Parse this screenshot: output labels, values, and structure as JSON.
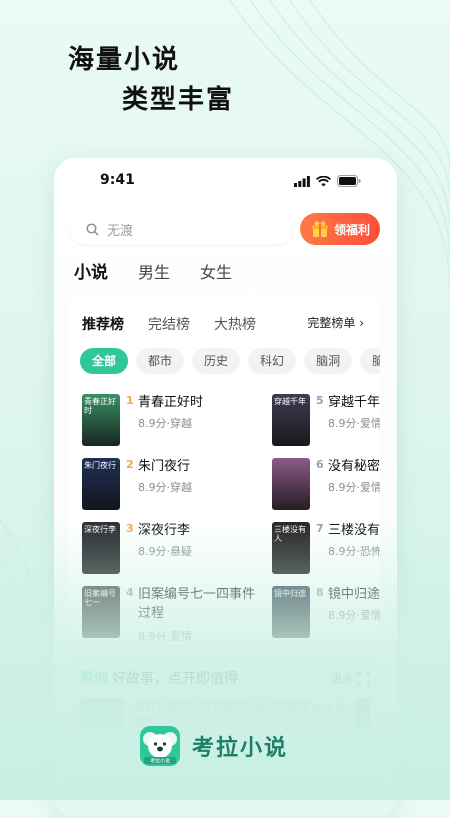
{
  "promo": {
    "line1": "海量小说",
    "line2": "类型丰富"
  },
  "status": {
    "time": "9:41"
  },
  "search": {
    "placeholder": "无渡"
  },
  "welfare": {
    "label": "领福利"
  },
  "tabs": [
    {
      "label": "小说",
      "active": true
    },
    {
      "label": "男生",
      "active": false
    },
    {
      "label": "女生",
      "active": false
    }
  ],
  "rank_tabs": [
    {
      "label": "推荐榜",
      "active": true
    },
    {
      "label": "完结榜",
      "active": false
    },
    {
      "label": "大热榜",
      "active": false
    }
  ],
  "full_rank": "完整榜单 ›",
  "categories": [
    {
      "label": "全部",
      "active": true
    },
    {
      "label": "都市",
      "active": false
    },
    {
      "label": "历史",
      "active": false
    },
    {
      "label": "科幻",
      "active": false
    },
    {
      "label": "脑洞",
      "active": false
    },
    {
      "label": "脑",
      "active": false
    }
  ],
  "books": [
    {
      "rank": "1",
      "title": "青春正好时",
      "meta": "8.9分·穿越",
      "cover_text": "青春正好时",
      "cover_color": "#3c8f67",
      "rank_color": "#f0a84a"
    },
    {
      "rank": "2",
      "title": "朱门夜行",
      "meta": "8.9分·穿越",
      "cover_text": "朱门夜行",
      "cover_color": "#1f2f57",
      "rank_color": "#f0a84a"
    },
    {
      "rank": "3",
      "title": "深夜行李",
      "meta": "8.9分·悬疑",
      "cover_text": "深夜行李",
      "cover_color": "#2b2f36",
      "rank_color": "#f0a84a"
    },
    {
      "rank": "4",
      "title": "旧案编号七一四事件过程",
      "meta": "8.9分·爱情",
      "cover_text": "旧案编号七一",
      "cover_color": "#3e3f43",
      "rank_color": "#9aa0a6"
    },
    {
      "rank": "5",
      "title": "穿越千年",
      "meta": "8.9分·爱情",
      "cover_text": "穿越千年",
      "cover_color": "#433b55",
      "rank_color": "#9aa0a6"
    },
    {
      "rank": "6",
      "title": "没有秘密",
      "meta": "8.9分·爱情",
      "cover_text": "",
      "cover_color": "#8c5a86",
      "rank_color": "#9aa0a6"
    },
    {
      "rank": "7",
      "title": "三楼没有",
      "meta": "8.9分·恐怖",
      "cover_text": "三楼没有人",
      "cover_color": "#2b2326",
      "rank_color": "#9aa0a6"
    },
    {
      "rank": "8",
      "title": "镜中归途",
      "meta": "8.9分·爱情",
      "cover_text": "镜中归途",
      "cover_color": "#2e3f4f",
      "rank_color": "#9aa0a6"
    }
  ],
  "original": {
    "badge": "原创",
    "title": "好故事，点开即值得",
    "more": "更多",
    "desc": "没有秘密的你没有秘密的你没有秘密的你",
    "score": "9.3分"
  },
  "brand": {
    "name": "考拉小说",
    "logo_text": "考拉小说"
  },
  "colors": {
    "accent": "#2fc79a",
    "welfare": "#ff5a3c",
    "rank_top": "#f0a84a"
  }
}
